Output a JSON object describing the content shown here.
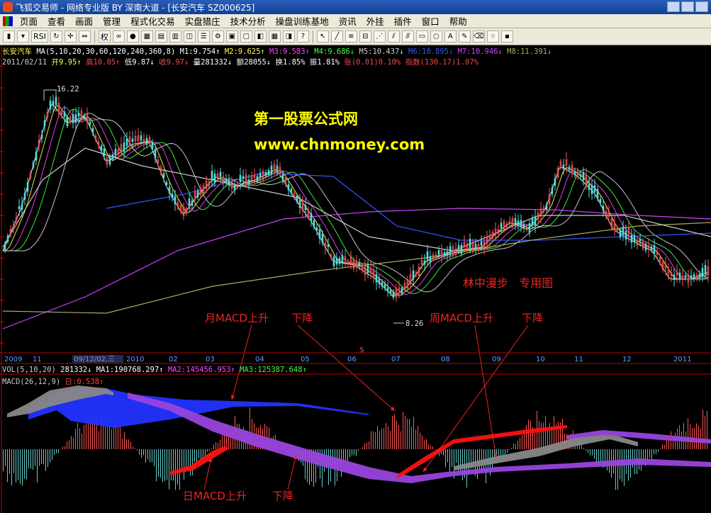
{
  "window": {
    "title": "飞狐交易师 - 网络专业版 BY 深南大道 - [长安汽车 SZ000625]"
  },
  "menu": {
    "items": [
      "页面",
      "查看",
      "画面",
      "管理",
      "程式化交易",
      "实盘猎庄",
      "技术分析",
      "操盘训练基地",
      "资讯",
      "外挂",
      "插件",
      "窗口",
      "帮助"
    ]
  },
  "toolbar": {
    "rsi_label": "RSI",
    "quan_label": "权"
  },
  "price_panel": {
    "stock_name": "长安汽车",
    "ma_line": [
      {
        "text": "MA(5,10,20,30,60,120,240,360,8)",
        "color": "#ffffff"
      },
      {
        "text": "M1:9.754↑",
        "color": "#ffffff"
      },
      {
        "text": "M2:9.625↑",
        "color": "#ffff55"
      },
      {
        "text": "M3:9.583↑",
        "color": "#ff44ff"
      },
      {
        "text": "M4:9.686↓",
        "color": "#44ff44"
      },
      {
        "text": "M5:10.437↓",
        "color": "#cccccc"
      },
      {
        "text": "M6:10.895↓",
        "color": "#3355ff"
      },
      {
        "text": "M7:10.946↓",
        "color": "#cc44ff"
      },
      {
        "text": "M8:11.391↓",
        "color": "#aaaa66"
      }
    ],
    "quote_line": [
      {
        "text": "2011/02/11",
        "color": "#cccccc"
      },
      {
        "text": "开9.95↑",
        "color": "#ffff55"
      },
      {
        "text": "高10.05↑",
        "color": "#ff4444"
      },
      {
        "text": "低9.87↓",
        "color": "#ffffff"
      },
      {
        "text": "收9.97↓",
        "color": "#ff4444"
      },
      {
        "text": "量281332↓",
        "color": "#ffffff"
      },
      {
        "text": "额28055↓",
        "color": "#ffffff"
      },
      {
        "text": "换1.85%",
        "color": "#ffffff"
      },
      {
        "text": "振1.81%",
        "color": "#ffffff"
      },
      {
        "text": "张(0.01)0.10%",
        "color": "#ff4444"
      },
      {
        "text": "指数(130.17)1.07%",
        "color": "#ff4444"
      }
    ],
    "high_label": "16.22",
    "low_label": "8.26",
    "watermark_title": "第一股票公式网",
    "watermark_url": "www.chnmoney.com",
    "caption": "林中漫步   专用图"
  },
  "date_axis": {
    "labels": [
      "2009",
      "11",
      "09/12/02,三",
      "2010",
      "02",
      "03",
      "04",
      "05",
      "06",
      "07",
      "08",
      "09",
      "10",
      "11",
      "12",
      "2011"
    ],
    "marker": "$"
  },
  "vol_panel": [
    {
      "text": "VOL(5,10,20)",
      "color": "#cccccc"
    },
    {
      "text": "281332↓",
      "color": "#ffffff"
    },
    {
      "text": "MA1:190768.297↑",
      "color": "#ffffff"
    },
    {
      "text": "MA2:145456.953↑",
      "color": "#ff44ff"
    },
    {
      "text": "MA3:125387.648↑",
      "color": "#44ff44"
    }
  ],
  "macd_panel": [
    {
      "text": "MACD(26,12,9)",
      "color": "#cccccc"
    },
    {
      "text": "日:0.538↑",
      "color": "#ff4444"
    }
  ],
  "annotations": {
    "month_up": "月MACD上升",
    "month_down": "下降",
    "week_up": "周MACD上升",
    "week_down": "下降",
    "day_up": "日MACD上升",
    "day_down": "下降"
  },
  "colors": {
    "up_candle": "#ff5555",
    "down_candle": "#55dddd",
    "month_macd_up": "#2233ff",
    "month_macd_down": "#9944dd",
    "week_macd_up": "#ff1111",
    "week_macd_down": "#888888",
    "annotation": "#ee2222",
    "watermark": "#ffff00"
  }
}
